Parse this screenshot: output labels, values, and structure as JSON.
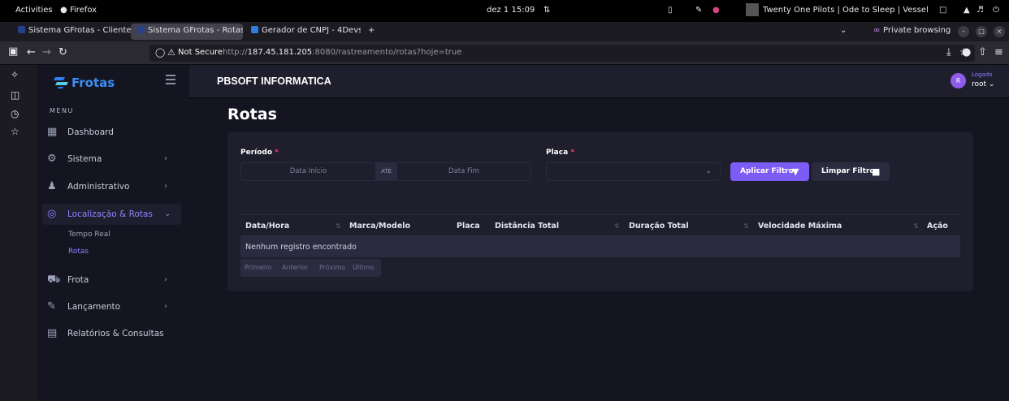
{
  "system_bar": {
    "activities": "Activities",
    "app": "Firefox",
    "clock": "dez 1  15:09",
    "media": "Twenty One Pilots | Ode to Sleep | Vessel"
  },
  "browser": {
    "tabs": [
      {
        "label": "Sistema GFrotas - Cliente",
        "active": false
      },
      {
        "label": "Sistema GFrotas - Rotas",
        "active": true
      },
      {
        "label": "Gerador de CNPJ - 4Devs",
        "active": false
      }
    ],
    "private_label": "Private browsing",
    "not_secure": "Not Secure",
    "url_prefix": "http://",
    "url_host": "187.45.181.205",
    "url_rest": ":8080/rastreamento/rotas?hoje=true"
  },
  "sidebar": {
    "brand": "Frotas",
    "menu_title": "MENU",
    "items": [
      {
        "label": "Dashboard"
      },
      {
        "label": "Sistema"
      },
      {
        "label": "Administrativo"
      },
      {
        "label": "Localização & Rotas"
      },
      {
        "label": "Frota"
      },
      {
        "label": "Lançamento"
      },
      {
        "label": "Relatórios & Consultas"
      }
    ],
    "subitems": [
      {
        "label": "Tempo Real"
      },
      {
        "label": "Rotas"
      }
    ]
  },
  "header": {
    "company": "PBSOFT INFORMATICA",
    "avatar_initial": "R",
    "status": "Logado",
    "user": "root"
  },
  "page": {
    "title": "Rotas",
    "filters": {
      "periodo_label": "Período",
      "placa_label": "Placa",
      "required_mark": "*",
      "start_placeholder": "Data Início",
      "separator": "ATÉ",
      "end_placeholder": "Data Fim",
      "placa_value": "",
      "apply_label": "Aplicar Filtro",
      "clear_label": "Limpar Filtro"
    },
    "table": {
      "columns": [
        "Data/Hora",
        "Marca/Modelo",
        "Placa",
        "Distância Total",
        "Duração Total",
        "Velocidade Máxima",
        "Ação"
      ],
      "empty_message": "Nenhum registro encontrado"
    },
    "pagination": {
      "first": "Primeiro",
      "prev": "Anterior",
      "next": "Próximo",
      "last": "Último"
    }
  },
  "colors": {
    "accent": "#7d5cf5",
    "active_menu": "#8f83ff",
    "brand_blue": "#3b8ef3",
    "required": "#f1416c"
  }
}
